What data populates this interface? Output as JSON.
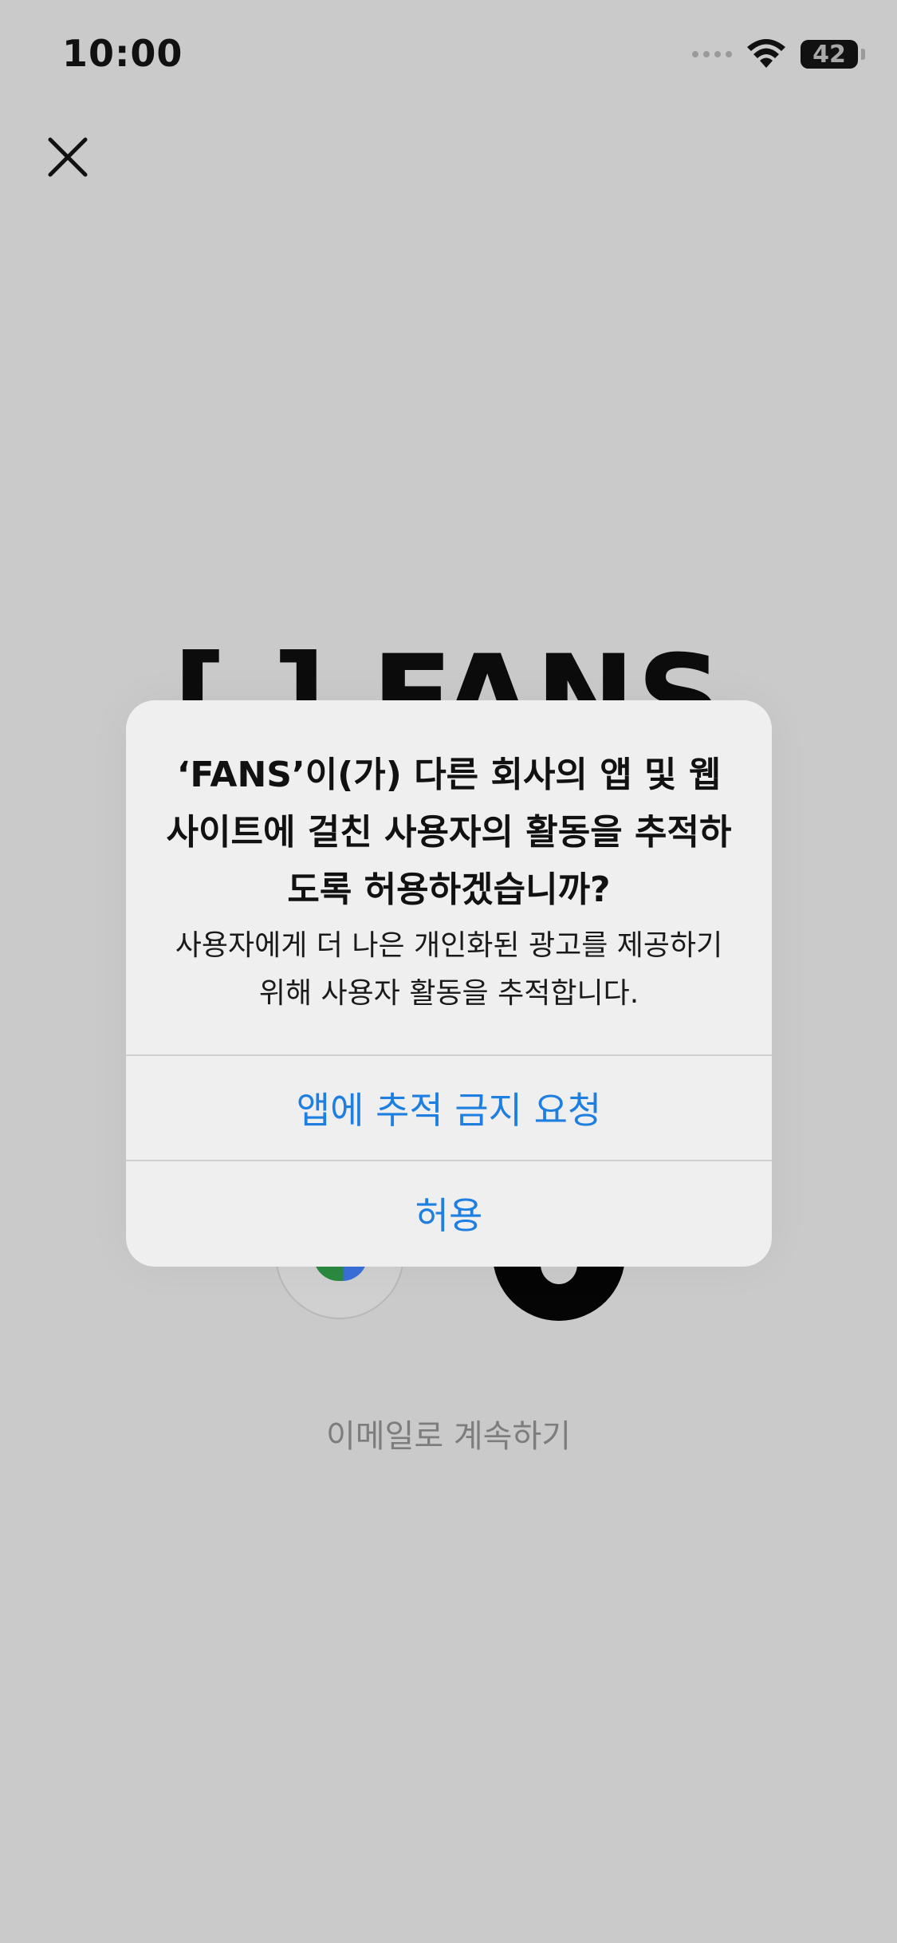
{
  "status_bar": {
    "time": "10:00",
    "battery": "42",
    "battery_level": 0.42
  },
  "background": {
    "brand_logo": "[ ] FANS",
    "email_link": "이메일로 계속하기"
  },
  "dialog": {
    "title": "‘FANS’이(가) 다른 회사의 앱 및 웹사이트에 걸친 사용자의 활동을 추적하도록 허용하겠습니까?",
    "message": "사용자에게 더 나은 개인화된 광고를 제공하기 위해 사용자 활동을 추적합니다.",
    "deny_label": "앱에 추적 금지 요청",
    "allow_label": "허용"
  },
  "colors": {
    "accent": "#1f7fe0",
    "background": "#cacaca",
    "dialog": "#efefef"
  },
  "icons": {
    "close": "close-icon",
    "wifi": "wifi-icon",
    "battery": "battery-icon",
    "google": "google-icon",
    "apple": "apple-icon"
  }
}
